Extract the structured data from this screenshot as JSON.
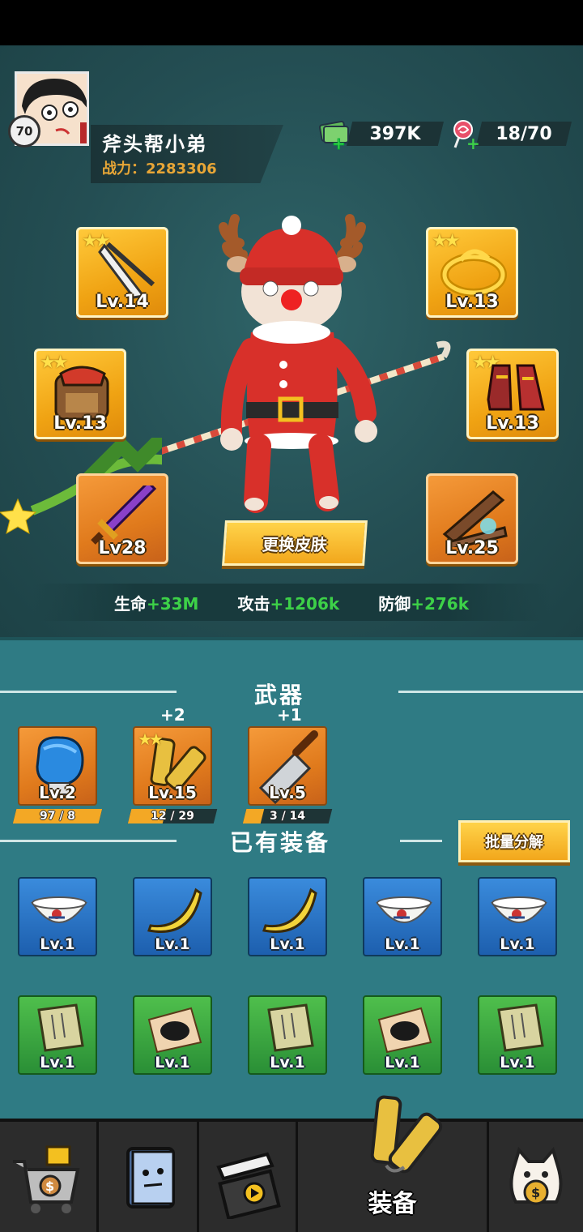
{
  "player": {
    "name": "斧头帮小弟",
    "level": "70",
    "power": "战力：2283306"
  },
  "currencies": {
    "cash": "397K",
    "candy": "18/70"
  },
  "equip_slots": {
    "weapon_top_left": "Lv.14",
    "ring_top_right": "Lv.13",
    "armor_mid_left": "Lv.13",
    "boots_mid_right": "Lv.13",
    "sword_bottom_left": "Lv28",
    "book_bottom_right": "Lv.25"
  },
  "skin_button": "更换皮肤",
  "stats": {
    "hp_label": "生命",
    "hp_value": "+33M",
    "atk_label": "攻击",
    "atk_value": "+1206k",
    "def_label": "防御",
    "def_value": "+276k"
  },
  "weapons_section": {
    "title": "武器",
    "items": [
      {
        "name": "boxing-glove",
        "level": "Lv.2",
        "plus": "",
        "progress": "97 / 8",
        "fill": 1.0
      },
      {
        "name": "nunchaku",
        "level": "Lv.15",
        "plus": "+2",
        "progress": "12 / 29",
        "fill": 0.41
      },
      {
        "name": "cleaver",
        "level": "Lv.5",
        "plus": "+1",
        "progress": "3 / 14",
        "fill": 0.21
      }
    ]
  },
  "owned_section": {
    "title": "已有装备",
    "batch_button": "批量分解",
    "rows": [
      [
        "Lv.1",
        "Lv.1",
        "Lv.1",
        "Lv.1",
        "Lv.1"
      ],
      [
        "Lv.1",
        "Lv.1",
        "Lv.1",
        "Lv.1",
        "Lv.1"
      ]
    ]
  },
  "nav": {
    "active_label": "装备"
  }
}
